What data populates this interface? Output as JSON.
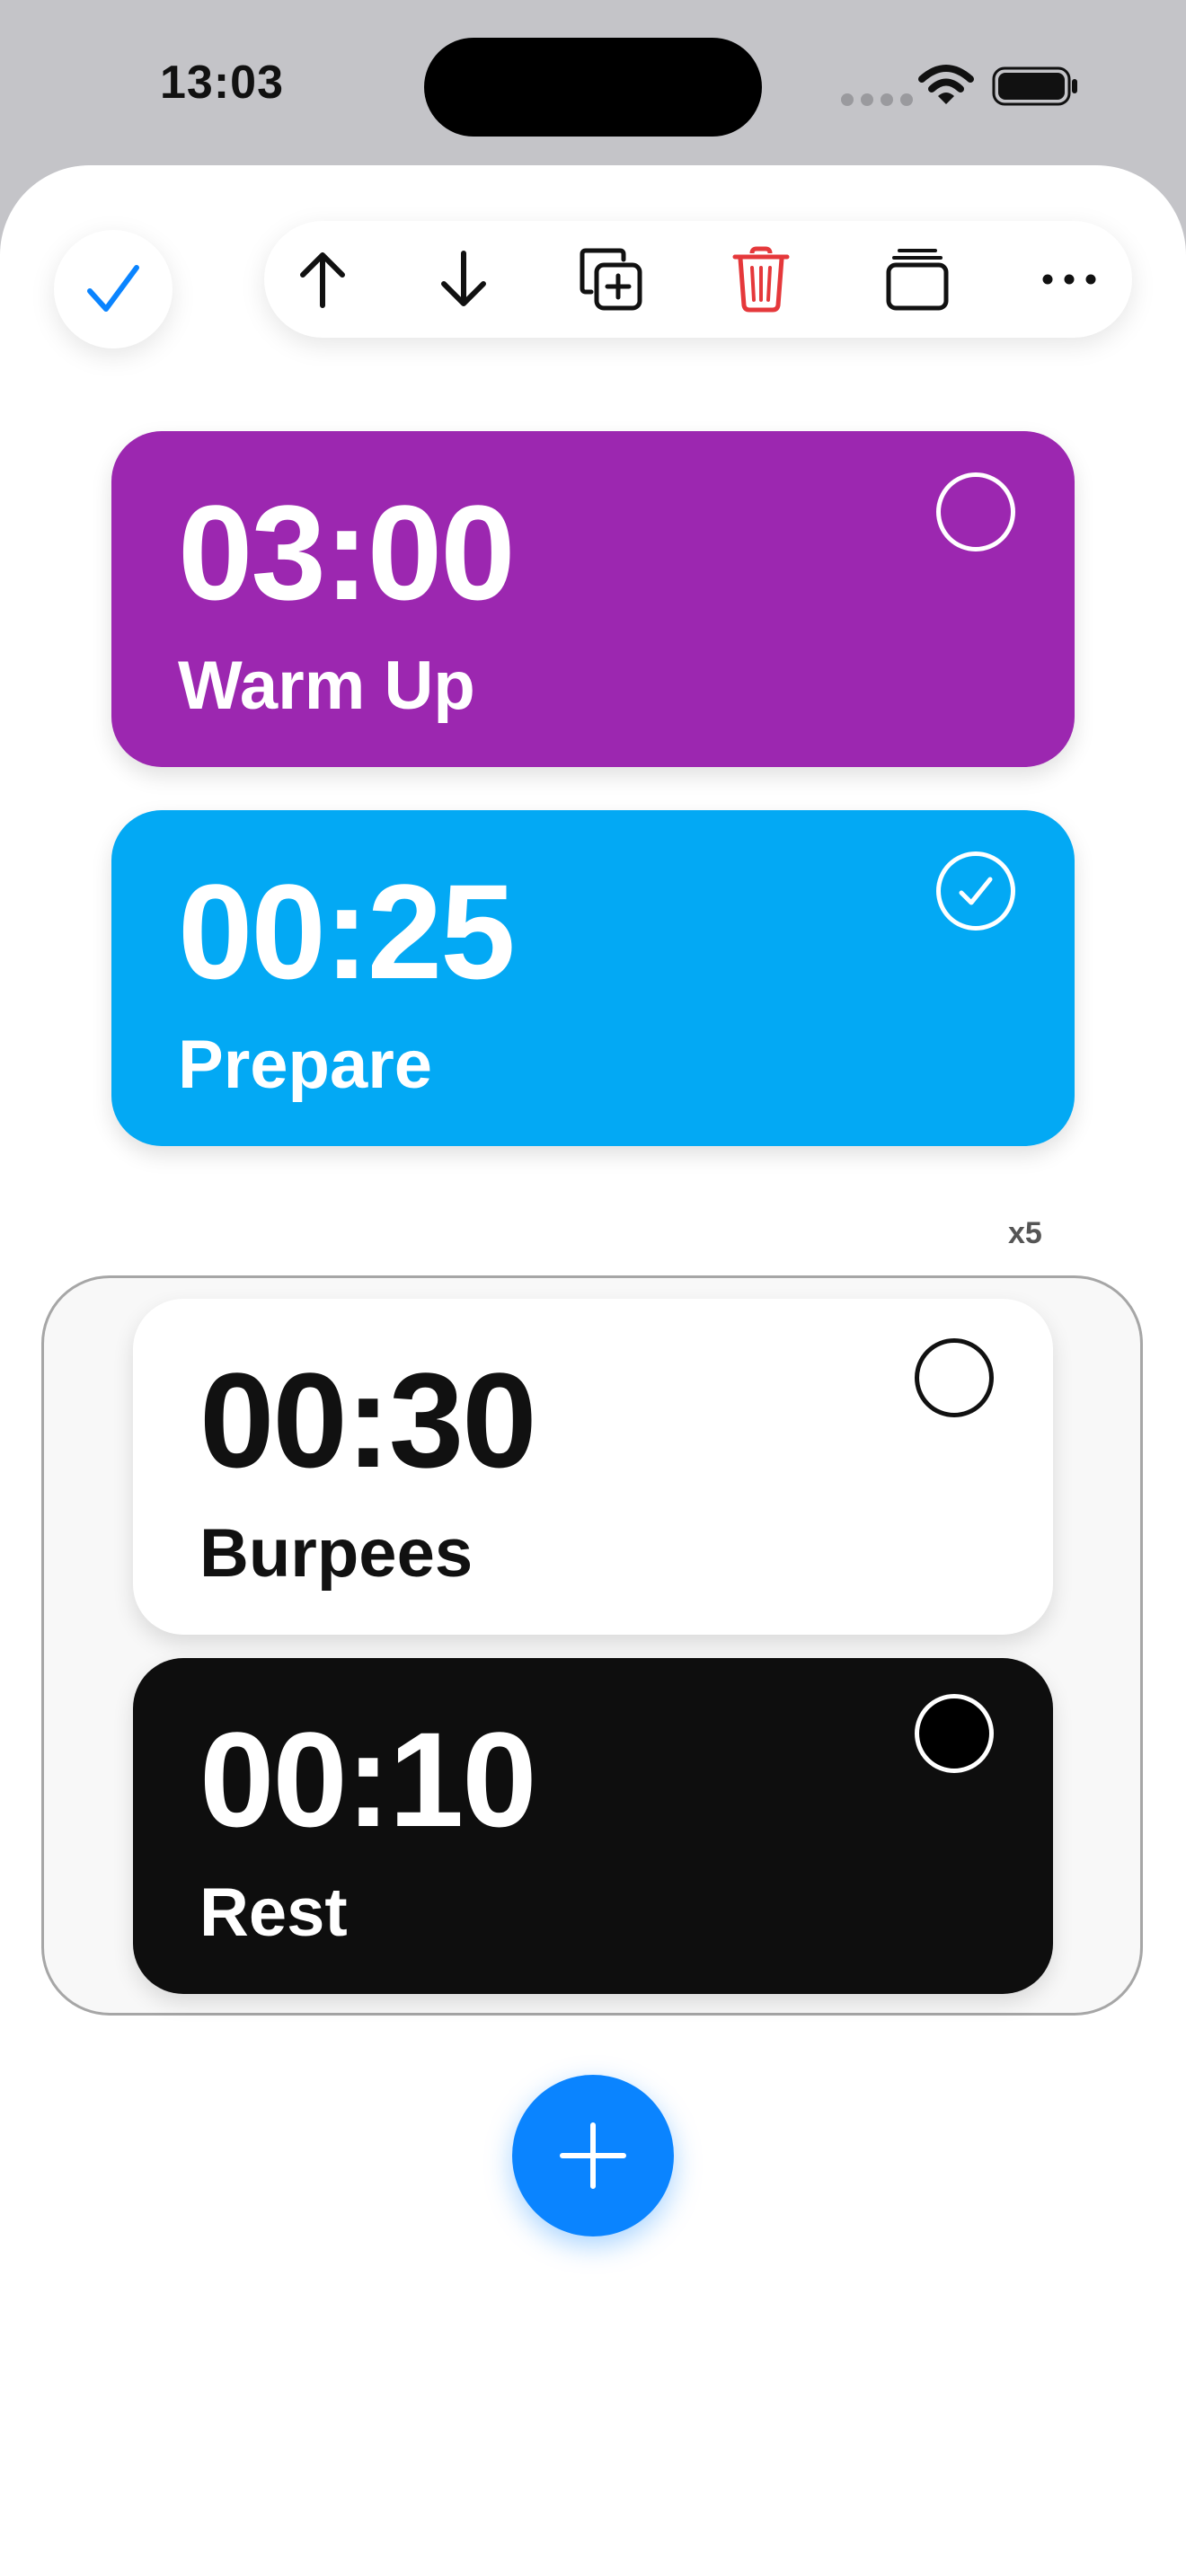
{
  "status_bar": {
    "time": "13:03"
  },
  "toolbar": {
    "done": "checkmark-icon",
    "actions": [
      "arrow-up-icon",
      "arrow-down-icon",
      "duplicate-icon",
      "trash-icon",
      "stack-icon",
      "more-icon"
    ]
  },
  "colors": {
    "accent": "#0a84ff",
    "delete": "#e5383b",
    "warmup": "#9c27b0",
    "prepare": "#03a9f4",
    "burpees": "#ffffff",
    "rest": "#0e0e0e"
  },
  "timers": [
    {
      "time": "03:00",
      "label": "Warm Up",
      "selected": false
    },
    {
      "time": "00:25",
      "label": "Prepare",
      "selected": true
    }
  ],
  "group": {
    "repeat": "x5",
    "timers": [
      {
        "time": "00:30",
        "label": "Burpees",
        "selected": false
      },
      {
        "time": "00:10",
        "label": "Rest",
        "selected": false
      }
    ]
  },
  "add_button": "plus-icon"
}
